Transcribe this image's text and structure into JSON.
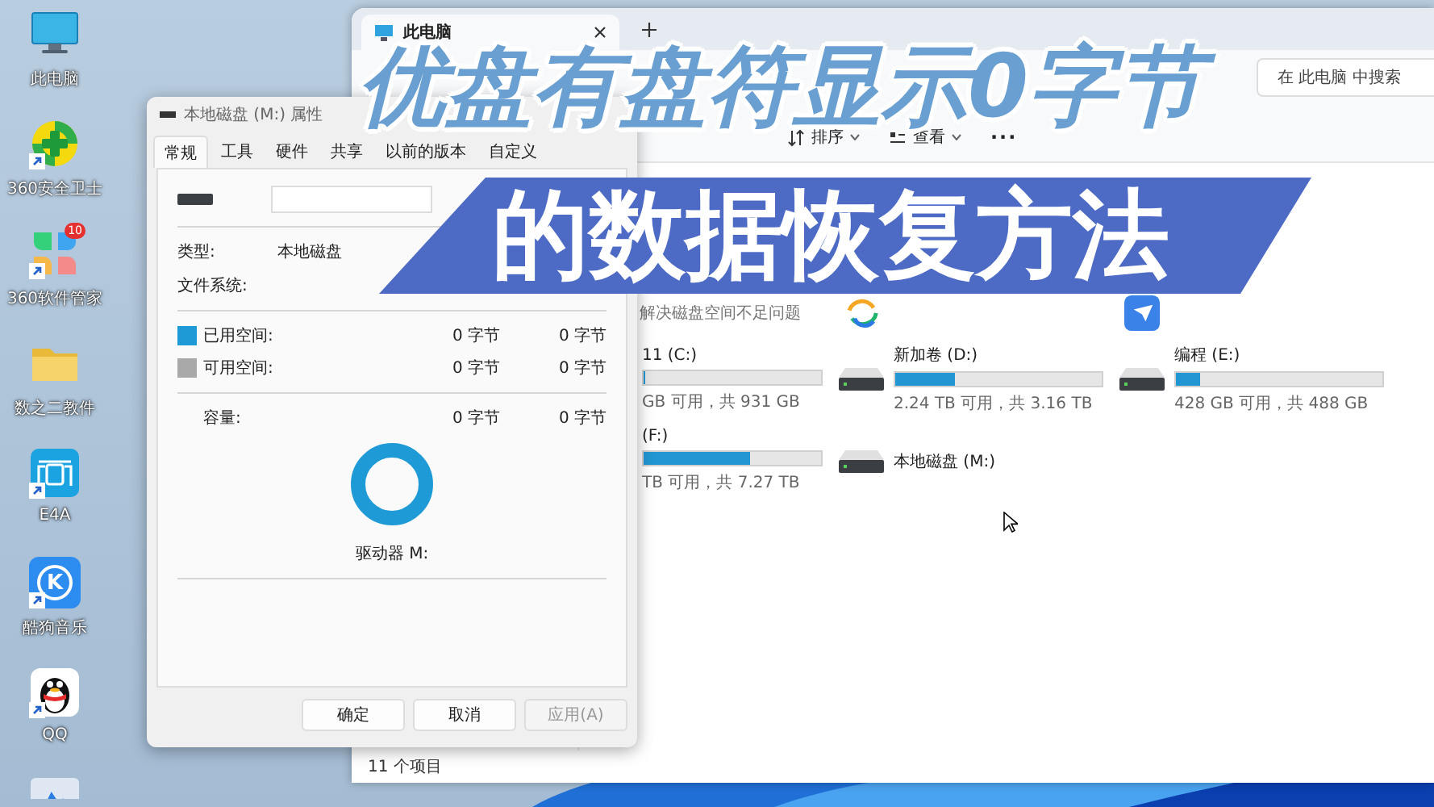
{
  "desktop": {
    "icons": [
      {
        "kind": "pc",
        "label": "此电脑",
        "shortcut": false
      },
      {
        "kind": "security",
        "label": "360安全卫士",
        "shortcut": true
      },
      {
        "kind": "apps",
        "label": "360软件管家",
        "shortcut": true,
        "badge": "10"
      },
      {
        "kind": "folder",
        "label": "数之二教件",
        "shortcut": false
      },
      {
        "kind": "e4a",
        "label": "E4A",
        "shortcut": true
      },
      {
        "kind": "kugou",
        "label": "酷狗音乐",
        "shortcut": true,
        "logo_text": "K"
      },
      {
        "kind": "qq",
        "label": "QQ",
        "shortcut": true
      },
      {
        "kind": "recycle"
      }
    ]
  },
  "explorer": {
    "tab": {
      "title": "此电脑"
    },
    "search": {
      "placeholder": "在 此电脑 中搜索"
    },
    "toolbar": [
      {
        "kind": "sort",
        "label": "排序"
      },
      {
        "kind": "view",
        "label": "查看"
      }
    ],
    "more": "···",
    "hint": "解决磁盘空间不足问题",
    "app_tiles": [
      {
        "kind": "swirl"
      },
      {
        "kind": "feather"
      }
    ],
    "drives": [
      {
        "name": "11 (C:)",
        "level": 0.01,
        "info": "GB 可用，共 931 GB"
      },
      {
        "name": "新加卷 (D:)",
        "level": 0.29,
        "info": "2.24 TB 可用，共 3.16 TB"
      },
      {
        "name": "编程 (E:)",
        "level": 0.12,
        "info": "428 GB 可用，共 488 GB"
      },
      {
        "name": "(F:)",
        "level": 0.6,
        "info": "TB 可用，共 7.27 TB"
      },
      {
        "name": "本地磁盘 (M:)"
      }
    ],
    "status_bar": "11 个项目"
  },
  "dialog": {
    "title": "本地磁盘 (M:) 属性",
    "tabs": [
      {
        "label": "常规",
        "selected": true
      },
      {
        "label": "工具",
        "selected": false
      },
      {
        "label": "硬件",
        "selected": false
      },
      {
        "label": "共享",
        "selected": false
      },
      {
        "label": "以前的版本",
        "selected": false
      },
      {
        "label": "自定义",
        "selected": false
      }
    ],
    "info": [
      {
        "label": "类型:",
        "value": "本地磁盘"
      },
      {
        "label": "文件系统:"
      }
    ],
    "space": [
      {
        "label": "已用空间:",
        "color": "#1e9ad6",
        "value_1": "0 字节",
        "value_2": "0 字节"
      },
      {
        "label": "可用空间:",
        "color": "#a9a9a9",
        "value_1": "0 字节",
        "value_2": "0 字节"
      }
    ],
    "capacity": {
      "label": "容量:",
      "value_1": "0 字节",
      "value_2": "0 字节"
    },
    "drive_label": "驱动器 M:",
    "buttons": [
      {
        "label": "确定",
        "disabled": false
      },
      {
        "label": "取消",
        "disabled": false
      },
      {
        "label": "应用(A)",
        "disabled": true
      }
    ]
  },
  "banner": {
    "line_1": "优盘有盘符显示0字节",
    "line_2": "的数据恢复方法"
  }
}
